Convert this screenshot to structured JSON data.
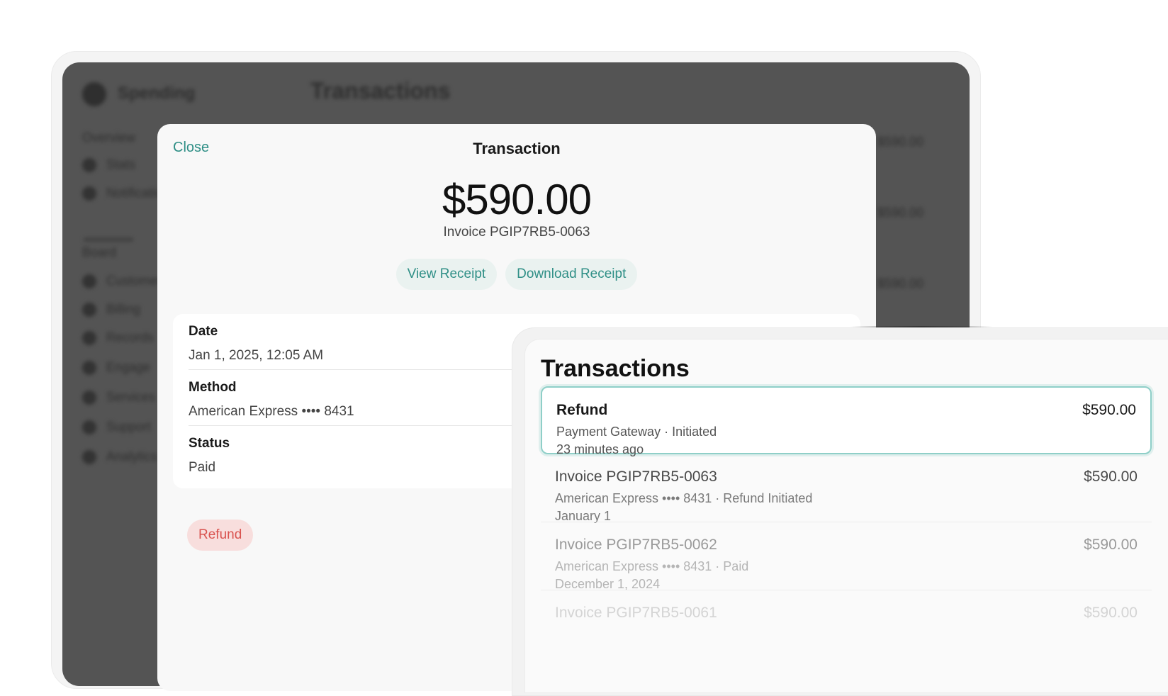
{
  "background": {
    "brand": "Spending",
    "title": "Transactions",
    "sidebar": [
      "Overview",
      "Stats",
      "Notifications",
      "Board",
      "Customers",
      "Billing",
      "Records",
      "Engage",
      "Services",
      "Support",
      "Analytics"
    ],
    "amounts": [
      "$590.00",
      "$590.00",
      "$590.00"
    ]
  },
  "modal": {
    "close_label": "Close",
    "title": "Transaction",
    "amount": "$590.00",
    "invoice": "Invoice PGIP7RB5-0063",
    "view_receipt": "View Receipt",
    "download_receipt": "Download Receipt",
    "details": [
      {
        "label": "Date",
        "value": "Jan 1, 2025, 12:05 AM"
      },
      {
        "label": "Method",
        "value": "American Express •••• 8431"
      },
      {
        "label": "Status",
        "value": "Paid"
      }
    ],
    "refund_label": "Refund"
  },
  "panel": {
    "title": "Transactions",
    "items": [
      {
        "title": "Refund",
        "amount": "$590.00",
        "sub": "Payment Gateway · Initiated",
        "time": "23 minutes ago"
      },
      {
        "title": "Invoice PGIP7RB5-0063",
        "amount": "$590.00",
        "sub": "American Express •••• 8431 · Refund Initiated",
        "time": "January 1"
      },
      {
        "title": "Invoice PGIP7RB5-0062",
        "amount": "$590.00",
        "sub": "American Express •••• 8431 · Paid",
        "time": "December 1, 2024"
      },
      {
        "title": "Invoice PGIP7RB5-0061",
        "amount": "$590.00",
        "sub": "",
        "time": ""
      }
    ]
  },
  "colors": {
    "accent": "#2f8f86",
    "danger": "#d9534f",
    "selected_border": "#8fcfc8"
  }
}
